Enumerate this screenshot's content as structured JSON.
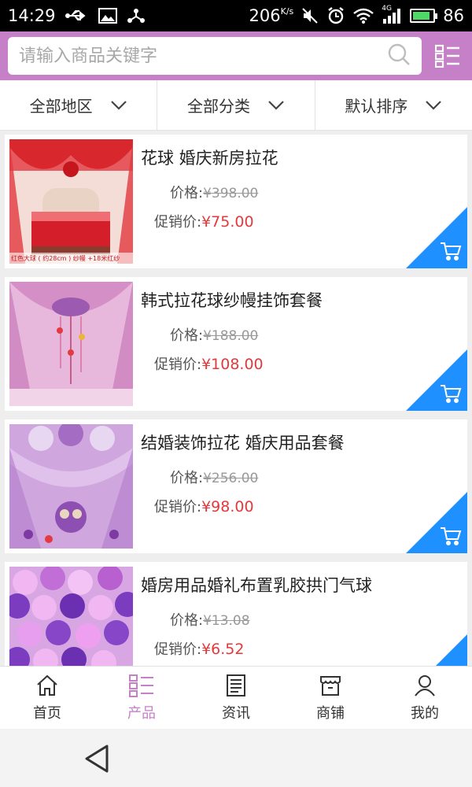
{
  "status_bar": {
    "time": "14:29",
    "speed": "206",
    "speed_unit": "K/s",
    "network": "4G",
    "battery": "86",
    "battery_level": 0.86
  },
  "search": {
    "placeholder": "请输入商品关键字",
    "icon": "search-icon",
    "menu_icon": "grid-list-icon"
  },
  "filters": [
    {
      "label": "全部地区"
    },
    {
      "label": "全部分类"
    },
    {
      "label": "默认排序"
    }
  ],
  "products": [
    {
      "name": "花球 婚庆新房拉花",
      "price_label": "价格:",
      "orig_price": "¥398.00",
      "promo_label": "促销价:",
      "promo_price": "¥75.00",
      "thumb_caption": "红色大球 ( 约28cm ) 纱幔 +18米红纱"
    },
    {
      "name": "韩式拉花球纱幔挂饰套餐",
      "price_label": "价格:",
      "orig_price": "¥188.00",
      "promo_label": "促销价:",
      "promo_price": "¥108.00"
    },
    {
      "name": "结婚装饰拉花 婚庆用品套餐",
      "price_label": "价格:",
      "orig_price": "¥256.00",
      "promo_label": "促销价:",
      "promo_price": "¥98.00"
    },
    {
      "name": "婚房用品婚礼布置乳胶拱门气球",
      "price_label": "价格:",
      "orig_price": "¥13.08",
      "promo_label": "促销价:",
      "promo_price": "¥6.52"
    }
  ],
  "bottom_nav": [
    {
      "label": "首页",
      "icon": "home-icon"
    },
    {
      "label": "产品",
      "icon": "product-list-icon",
      "active": true
    },
    {
      "label": "资讯",
      "icon": "news-icon"
    },
    {
      "label": "商铺",
      "icon": "shop-icon"
    },
    {
      "label": "我的",
      "icon": "user-icon"
    }
  ],
  "colors": {
    "accent": "#c680c8",
    "promo": "#e4393c",
    "cart": "#1e90ff"
  }
}
